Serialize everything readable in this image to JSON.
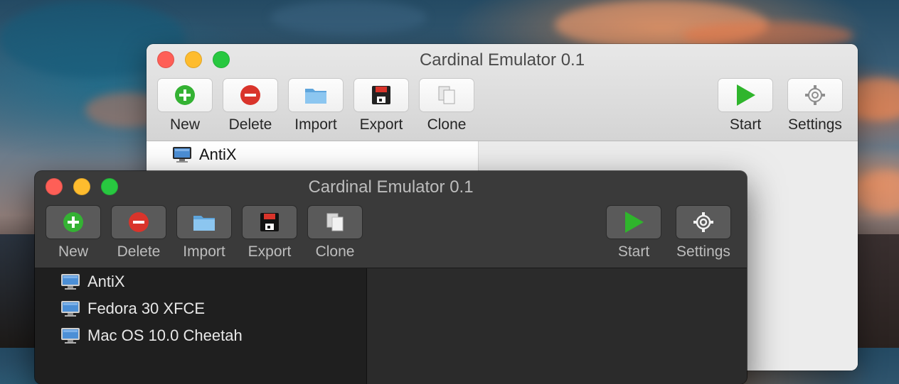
{
  "colors": {
    "accent_green": "#34b233",
    "accent_red": "#d9342b",
    "folder_blue": "#6fb3e6",
    "start_green": "#2fb52c"
  },
  "back_window": {
    "title": "Cardinal Emulator 0.1",
    "toolbar": {
      "new_label": "New",
      "delete_label": "Delete",
      "import_label": "Import",
      "export_label": "Export",
      "clone_label": "Clone",
      "start_label": "Start",
      "settings_label": "Settings"
    },
    "vm_list": [
      {
        "name": "AntiX",
        "icon": "monitor-icon"
      }
    ]
  },
  "front_window": {
    "title": "Cardinal Emulator 0.1",
    "toolbar": {
      "new_label": "New",
      "delete_label": "Delete",
      "import_label": "Import",
      "export_label": "Export",
      "clone_label": "Clone",
      "start_label": "Start",
      "settings_label": "Settings"
    },
    "vm_list": [
      {
        "name": "AntiX",
        "icon": "monitor-icon"
      },
      {
        "name": "Fedora 30 XFCE",
        "icon": "monitor-icon"
      },
      {
        "name": "Mac OS 10.0 Cheetah",
        "icon": "monitor-icon"
      }
    ]
  }
}
